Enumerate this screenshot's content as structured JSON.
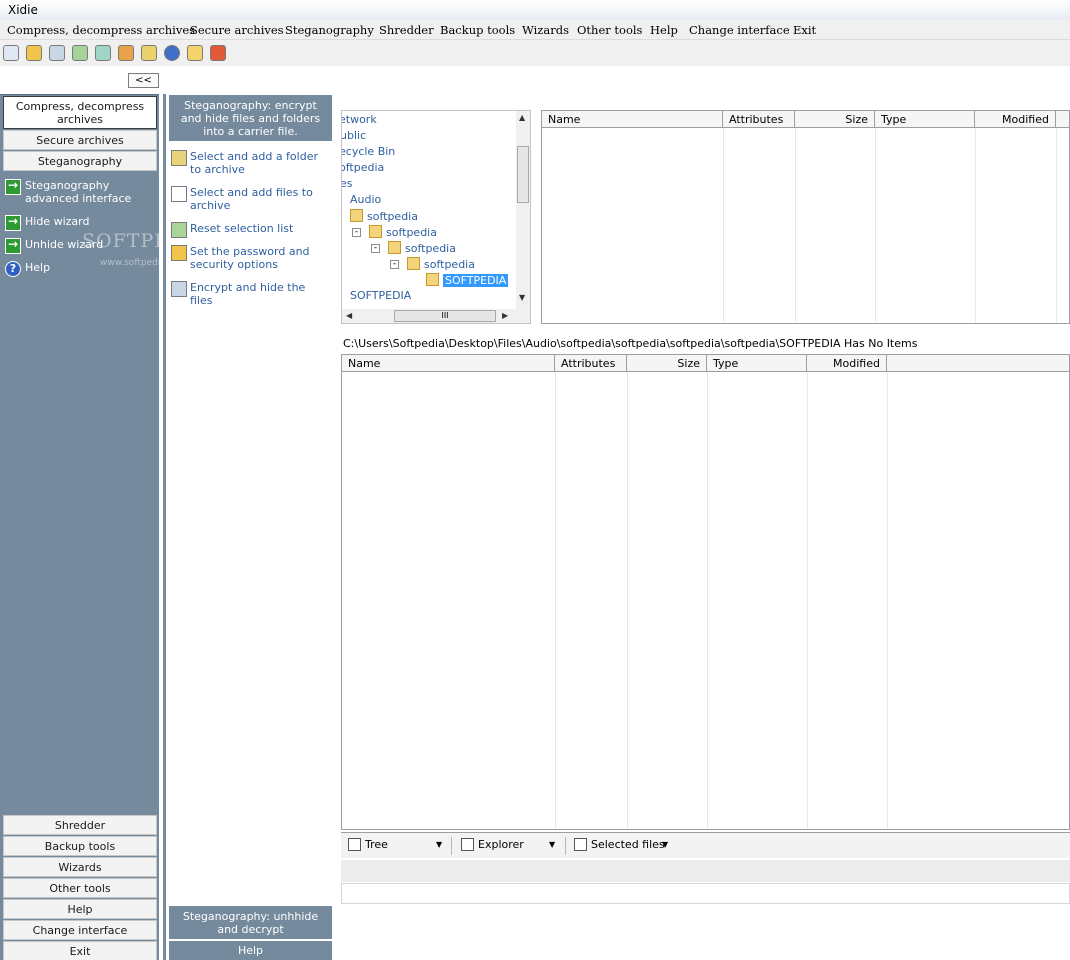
{
  "window": {
    "title": "Xidie"
  },
  "menu": [
    "Compress, decompress archives",
    "Secure archives",
    "Steganography",
    "Shredder",
    "Backup tools",
    "Wizards",
    "Other tools",
    "Help",
    "Change interface",
    "Exit"
  ],
  "toolbar": {
    "icons": [
      "compress-icon",
      "secure-icon",
      "steganography-icon",
      "shredder-icon",
      "backup-icon",
      "wizards-icon",
      "other-tools-icon",
      "help-icon",
      "change-interface-icon",
      "exit-icon"
    ],
    "collapse_label": "<<"
  },
  "left_nav": {
    "top_buttons": [
      "Compress, decompress archives",
      "Secure archives",
      "Steganography"
    ],
    "tasks": [
      "Steganography advanced interface",
      "Hide wizard",
      "Unhide wizard",
      "Help"
    ],
    "bottom_buttons": [
      "Shredder",
      "Backup tools",
      "Wizards",
      "Other tools",
      "Help",
      "Change interface",
      "Exit"
    ],
    "watermark": "SOFTPEDIA",
    "watermark_url": "www.softpedia.com"
  },
  "mid_panel": {
    "header": "Steganography: encrypt and hide files and folders into a carrier file.",
    "tasks": [
      "Select and add a folder to archive",
      "Select and add files to archive",
      "Reset selection list",
      "Set the password and security options",
      "Encrypt and hide the files"
    ],
    "footer_header": "Steganography: unhhide and decrypt",
    "footer_help": "Help"
  },
  "tree": {
    "items": [
      "etwork",
      "ublic",
      "ecycle Bin",
      "oftpedia",
      "es",
      "Audio",
      "softpedia",
      "softpedia",
      "softpedia",
      "softpedia",
      "SOFTPEDIA",
      "SOFTPEDIA"
    ],
    "hscroll_grip": "III"
  },
  "top_list": {
    "columns": [
      "Name",
      "Attributes",
      "Size",
      "Type",
      "Modified"
    ]
  },
  "status_path": "C:\\Users\\Softpedia\\Desktop\\Files\\Audio\\softpedia\\softpedia\\softpedia\\softpedia\\SOFTPEDIA Has No Items",
  "bottom_list": {
    "columns": [
      "Name",
      "Attributes",
      "Size",
      "Type",
      "Modified"
    ]
  },
  "view_toolbar": {
    "tree": "Tree",
    "explorer": "Explorer",
    "selected": "Selected files"
  },
  "colors": {
    "panel": "#758a9d",
    "link": "#2f5f9e",
    "selection": "#3399ff"
  }
}
